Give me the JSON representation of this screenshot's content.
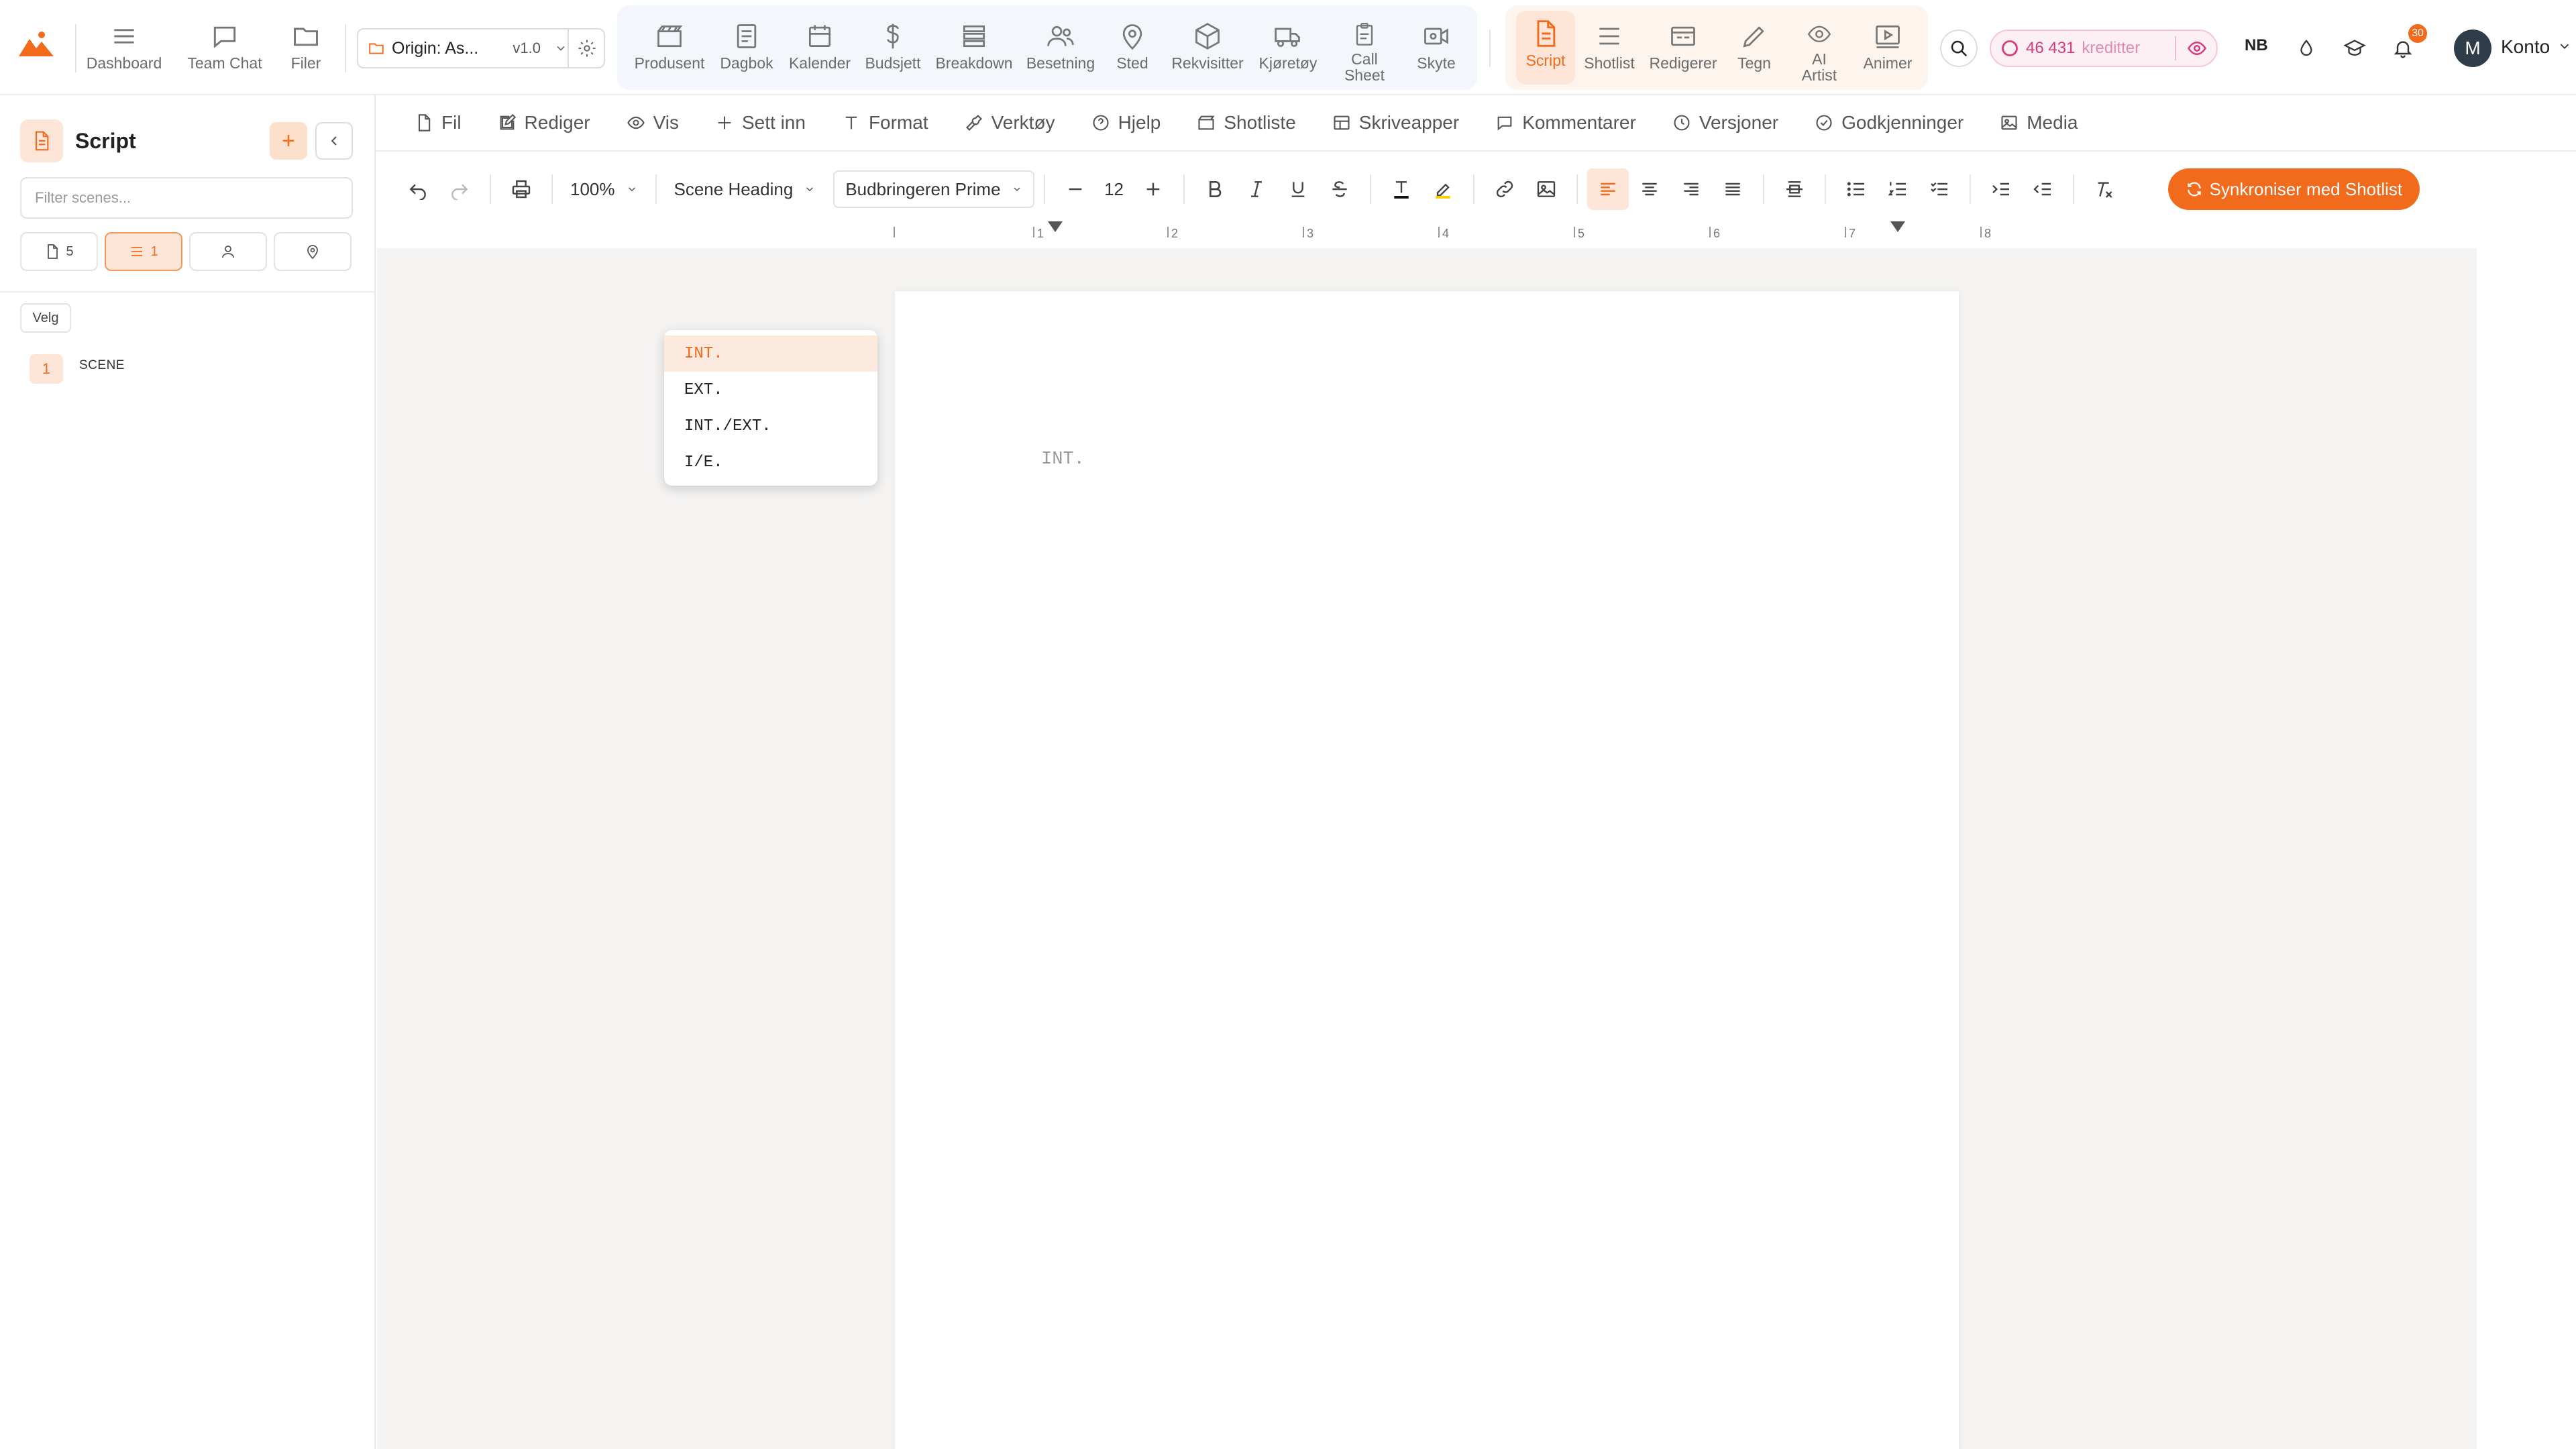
{
  "topbar": {
    "nav": [
      {
        "label": "Dashboard",
        "icon": "menu-icon"
      },
      {
        "label": "Team Chat",
        "icon": "chat-icon"
      },
      {
        "label": "Filer",
        "icon": "folder-icon"
      }
    ],
    "project": {
      "name": "Origin: As...",
      "version": "v1.0"
    },
    "production_tabs": [
      {
        "label": "Produsent",
        "icon": "clapper-icon"
      },
      {
        "label": "Dagbok",
        "icon": "notebook-icon"
      },
      {
        "label": "Kalender",
        "icon": "calendar-icon"
      },
      {
        "label": "Budsjett",
        "icon": "dollar-icon"
      },
      {
        "label": "Breakdown",
        "icon": "stack-icon"
      },
      {
        "label": "Besetning",
        "icon": "people-icon"
      },
      {
        "label": "Sted",
        "icon": "map-pin-icon"
      },
      {
        "label": "Rekvisitter",
        "icon": "box-icon"
      },
      {
        "label": "Kjøretøy",
        "icon": "truck-icon"
      },
      {
        "label": "Call\nSheet",
        "icon": "clipboard-icon"
      },
      {
        "label": "Skyte",
        "icon": "camera-icon"
      }
    ],
    "creative_tabs": [
      {
        "label": "Script",
        "icon": "script-icon",
        "active": true
      },
      {
        "label": "Shotlist",
        "icon": "list-icon"
      },
      {
        "label": "Redigerer",
        "icon": "film-icon"
      },
      {
        "label": "Tegn",
        "icon": "pencil-icon"
      },
      {
        "label": "AI\nArtist",
        "icon": "eye-icon"
      },
      {
        "label": "Animer",
        "icon": "play-icon"
      }
    ],
    "credits": {
      "amount": "46 431",
      "label": "kreditter"
    },
    "language": "NB",
    "notifications": "30",
    "avatar_initial": "M",
    "account": "Konto"
  },
  "sidebar": {
    "title": "Script",
    "filter_placeholder": "Filter scenes...",
    "tabs": [
      {
        "icon": "page-icon",
        "count": "5"
      },
      {
        "icon": "lines-icon",
        "count": "1"
      },
      {
        "icon": "person-icon",
        "count": ""
      },
      {
        "icon": "location-icon",
        "count": ""
      }
    ],
    "select_label": "Velg",
    "scenes": [
      {
        "number": "1",
        "label": "SCENE"
      }
    ]
  },
  "menubar": [
    {
      "label": "Fil",
      "icon": "file-icon"
    },
    {
      "label": "Rediger",
      "icon": "edit-icon"
    },
    {
      "label": "Vis",
      "icon": "eye-icon"
    },
    {
      "label": "Sett inn",
      "icon": "plus-icon"
    },
    {
      "label": "Format",
      "icon": "text-icon"
    },
    {
      "label": "Verktøy",
      "icon": "wrench-icon"
    },
    {
      "label": "Hjelp",
      "icon": "help-icon"
    },
    {
      "label": "Shotliste",
      "icon": "clapper-icon"
    },
    {
      "label": "Skriveapper",
      "icon": "grid-icon"
    },
    {
      "label": "Kommentarer",
      "icon": "comment-icon"
    },
    {
      "label": "Versjoner",
      "icon": "clock-icon"
    },
    {
      "label": "Godkjenninger",
      "icon": "check-circle-icon"
    },
    {
      "label": "Media",
      "icon": "image-icon"
    }
  ],
  "toolbar": {
    "zoom": "100%",
    "element_type": "Scene Heading",
    "font": "Budbringeren Prime",
    "font_size": "12",
    "sync_label": "Synkroniser med Shotlist",
    "accent": "#f26a1b"
  },
  "ruler": {
    "labels": [
      "1",
      "2",
      "3",
      "4",
      "5",
      "6",
      "7",
      "8"
    ]
  },
  "editor": {
    "placeholder_text": "INT."
  },
  "autocomplete": {
    "items": [
      "INT.",
      "EXT.",
      "INT./EXT.",
      "I/E."
    ],
    "highlighted": 0
  }
}
